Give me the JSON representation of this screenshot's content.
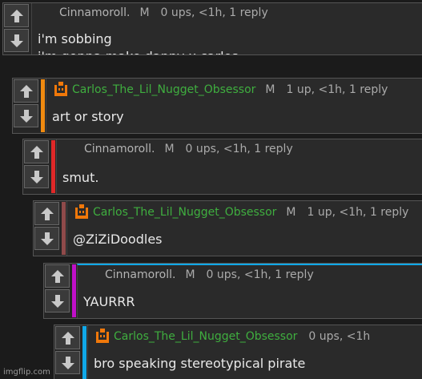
{
  "comments": [
    {
      "username": "Cinnamoroll.",
      "mod": "M",
      "stats": "0 ups, <1h, 1 reply",
      "lines": [
        "i'm sobbing",
        "i'm gonna make danny x carlos"
      ],
      "accent": ""
    },
    {
      "username": "Carlos_The_Lil_Nugget_Obsessor",
      "mod": "M",
      "stats": "1 up, <1h, 1 reply",
      "lines": [
        "art or story"
      ],
      "accent": "#f08a10"
    },
    {
      "username": "Cinnamoroll.",
      "mod": "M",
      "stats": "0 ups, <1h, 1 reply",
      "lines": [
        "smut."
      ],
      "accent": "#e02828"
    },
    {
      "username": "Carlos_The_Lil_Nugget_Obsessor",
      "mod": "M",
      "stats": "1 up, <1h, 1 reply",
      "lines": [
        "@ZiZiDoodles"
      ],
      "accent": "#8f4a4a"
    },
    {
      "username": "Cinnamoroll.",
      "mod": "M",
      "stats": "0 ups, <1h, 1 reply",
      "lines": [
        "YAURRR"
      ],
      "accent": "#c010c8"
    },
    {
      "username": "Carlos_The_Lil_Nugget_Obsessor",
      "mod": "",
      "stats": "0 ups, <1h",
      "lines": [
        "bro speaking stereotypical pirate"
      ],
      "accent": "#10a8e8"
    }
  ],
  "watermark": "imgflip.com"
}
